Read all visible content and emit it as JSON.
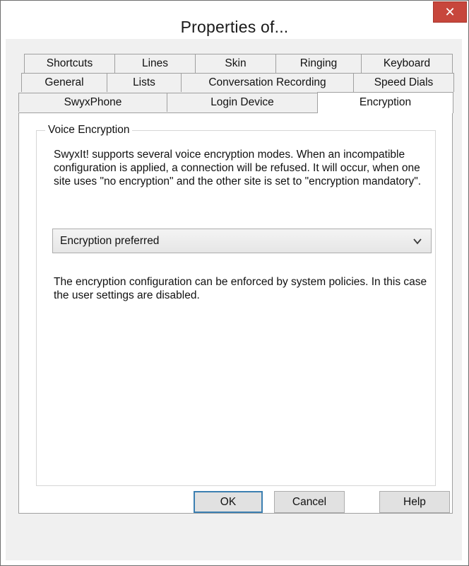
{
  "window": {
    "title": "Properties of...",
    "close_glyph": "✕"
  },
  "tabs": {
    "row1": [
      "Shortcuts",
      "Lines",
      "Skin",
      "Ringing",
      "Keyboard"
    ],
    "row2": [
      "General",
      "Lists",
      "Conversation Recording",
      "Speed Dials"
    ],
    "row3": [
      "SwyxPhone",
      "Login Device",
      "Encryption"
    ],
    "selected": "Encryption"
  },
  "encryption": {
    "group_label": "Voice Encryption",
    "description": "SwyxIt! supports several voice encryption modes. When an incompatible configuration is applied, a connection will be refused. It will occur, when one site uses \"no encryption\" and the other site is set to \"encryption mandatory\".",
    "mode_select": {
      "value": "Encryption preferred",
      "icon": "chevron-down-icon"
    },
    "policy_note": "The encryption configuration can be enforced by system policies. In this case the user settings are disabled."
  },
  "buttons": {
    "ok": "OK",
    "cancel": "Cancel",
    "help": "Help"
  },
  "colors": {
    "close_button": "#c7463c",
    "default_button_border": "#3c7fb1"
  }
}
